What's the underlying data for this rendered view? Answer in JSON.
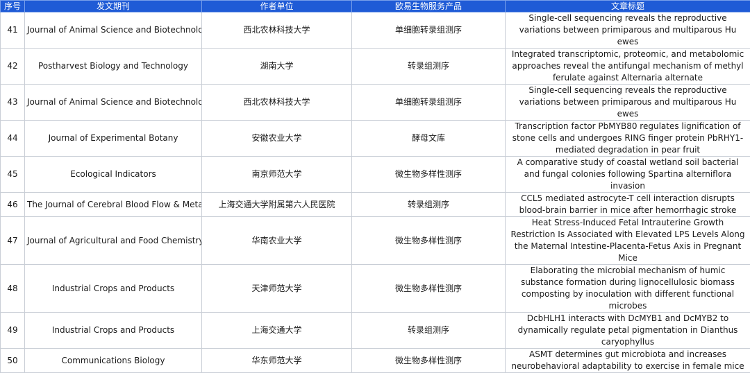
{
  "header": {
    "no": "序号",
    "journal": "发文期刊",
    "unit": "作者单位",
    "product": "欧易生物服务产品",
    "title": "文章标题"
  },
  "rows": [
    {
      "no": "41",
      "journal": "Journal of Animal Science and Biotechnology",
      "unit": "西北农林科技大学",
      "product": "单细胞转录组测序",
      "title": "Single-cell sequencing reveals the reproductive variations between primiparous and multiparous Hu ewes"
    },
    {
      "no": "42",
      "journal": "Postharvest Biology and Technology",
      "unit": "湖南大学",
      "product": "转录组测序",
      "title": "Integrated transcriptomic, proteomic, and metabolomic approaches reveal the antifungal mechanism of methyl ferulate against Alternaria alternate"
    },
    {
      "no": "43",
      "journal": "Journal of Animal Science and Biotechnology",
      "unit": "西北农林科技大学",
      "product": "单细胞转录组测序",
      "title": "Single-cell sequencing reveals the reproductive variations between primiparous and multiparous Hu ewes"
    },
    {
      "no": "44",
      "journal": "Journal of Experimental Botany",
      "unit": "安徽农业大学",
      "product": "酵母文库",
      "title": "Transcription factor PbMYB80 regulates lignification of stone cells and undergoes RING finger protein PbRHY1-mediated degradation in pear fruit"
    },
    {
      "no": "45",
      "journal": "Ecological Indicators",
      "unit": "南京师范大学",
      "product": "微生物多样性测序",
      "title": "A comparative study of coastal wetland soil bacterial and fungal colonies following Spartina alterniflora invasion"
    },
    {
      "no": "46",
      "journal": "The Journal of Cerebral Blood Flow & Metabolism",
      "unit": "上海交通大学附属第六人民医院",
      "product": "转录组测序",
      "title": "CCL5 mediated astrocyte-T cell interaction disrupts blood-brain barrier in mice after hemorrhagic stroke"
    },
    {
      "no": "47",
      "journal": "Journal of Agricultural and Food Chemistry",
      "unit": "华南农业大学",
      "product": "微生物多样性测序",
      "title": "Heat Stress-Induced Fetal Intrauterine Growth Restriction Is Associated with Elevated LPS Levels Along the Maternal Intestine-Placenta-Fetus Axis in Pregnant Mice"
    },
    {
      "no": "48",
      "journal": "Industrial Crops and Products",
      "unit": "天津师范大学",
      "product": "微生物多样性测序",
      "title": "Elaborating the microbial mechanism of humic substance formation during lignocellulosic biomass composting by inoculation with different functional microbes"
    },
    {
      "no": "49",
      "journal": "Industrial Crops and Products",
      "unit": "上海交通大学",
      "product": "转录组测序",
      "title": "DcbHLH1 interacts with DcMYB1 and DcMYB2 to dynamically regulate petal pigmentation in Dianthus caryophyllus"
    },
    {
      "no": "50",
      "journal": "Communications Biology",
      "unit": "华东师范大学",
      "product": "微生物多样性测序",
      "title": "ASMT determines gut microbiota and increases neurobehavioral adaptability to exercise in female mice"
    }
  ]
}
